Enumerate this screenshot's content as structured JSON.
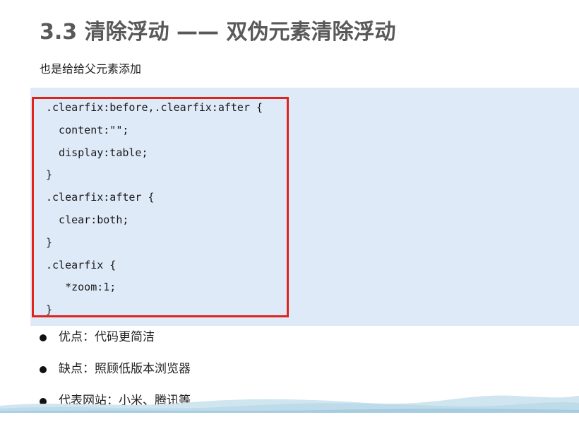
{
  "slide": {
    "title": "3.3 清除浮动 —— 双伪元素清除浮动",
    "subtitle": "也是给给父元素添加"
  },
  "code": {
    "lines": [
      ".clearfix:before,.clearfix:after {",
      "  content:\"\";",
      "  display:table;",
      "}",
      ".clearfix:after {",
      "  clear:both;",
      "}",
      ".clearfix {",
      "   *zoom:1;",
      "}"
    ]
  },
  "bullets": [
    "优点：代码更简洁",
    "缺点：照顾低版本浏览器",
    "代表网站：小米、腾讯等"
  ],
  "colors": {
    "title": "#595959",
    "code_background": "#dfeaf9",
    "highlight_border": "#e0231b",
    "footer_wave": "#b9d8e8"
  }
}
